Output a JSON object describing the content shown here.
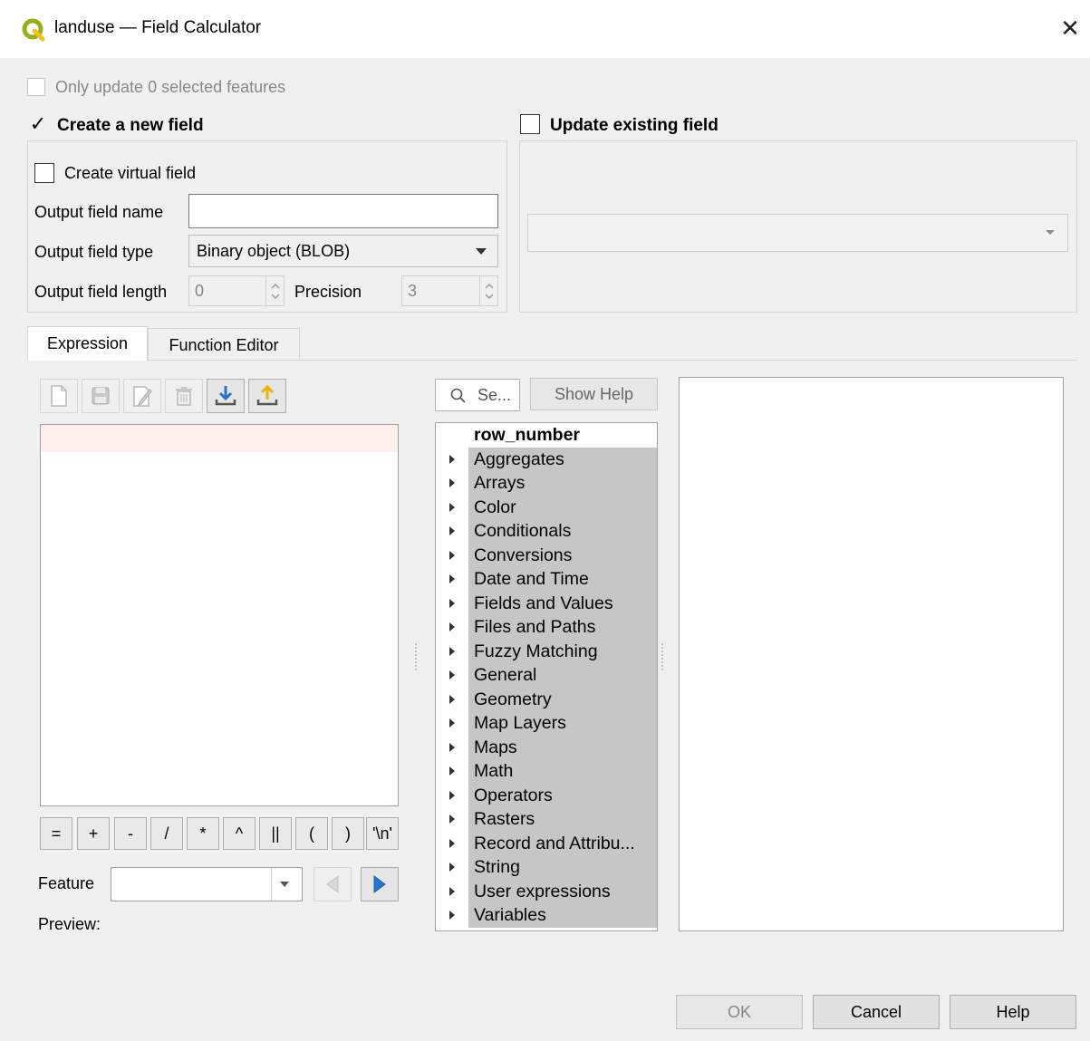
{
  "window": {
    "title": "landuse — Field Calculator",
    "close_symbol": "✕"
  },
  "options": {
    "only_update_label": "Only update 0 selected features",
    "create_new_field_label": "Create a new field",
    "update_existing_label": "Update existing field",
    "create_virtual_label": "Create virtual field",
    "output_field_name_label": "Output field name",
    "output_field_name_value": "",
    "output_field_type_label": "Output field type",
    "output_field_type_value": "Binary object (BLOB)",
    "output_field_length_label": "Output field length",
    "output_field_length_value": "0",
    "precision_label": "Precision",
    "precision_value": "3",
    "existing_field_value": ""
  },
  "tabs": [
    {
      "label": "Expression",
      "active": true
    },
    {
      "label": "Function Editor",
      "active": false
    }
  ],
  "toolbar_icons": [
    "new-file-icon",
    "save-icon",
    "edit-icon",
    "delete-icon",
    "import-icon",
    "export-icon"
  ],
  "operators": [
    "=",
    "+",
    "-",
    "/",
    "*",
    "^",
    "||",
    "(",
    ")",
    "'\\n'"
  ],
  "feature": {
    "label": "Feature",
    "value": "",
    "preview_label": "Preview:"
  },
  "search": {
    "placeholder": "Se...",
    "show_help_label": "Show Help"
  },
  "function_tree": {
    "items": [
      "row_number",
      "Aggregates",
      "Arrays",
      "Color",
      "Conditionals",
      "Conversions",
      "Date and Time",
      "Fields and Values",
      "Files and Paths",
      "Fuzzy Matching",
      "General",
      "Geometry",
      "Map Layers",
      "Maps",
      "Math",
      "Operators",
      "Rasters",
      "Record and Attribu...",
      "String",
      "User expressions",
      "Variables"
    ]
  },
  "buttons": {
    "ok": "OK",
    "cancel": "Cancel",
    "help": "Help"
  },
  "colors": {
    "qgis_green": "#93b023",
    "accent_blue": "#2b73c4",
    "expression_line_highlight": "#fdf0ea"
  }
}
